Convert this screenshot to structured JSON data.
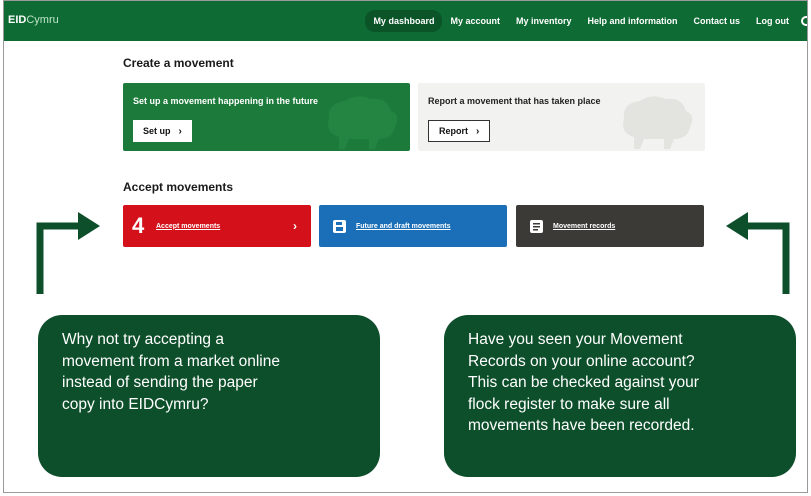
{
  "header": {
    "logo_main": "EID",
    "logo_rest": "Cymru",
    "nav": [
      {
        "label": "My dashboard",
        "active": true
      },
      {
        "label": "My account",
        "active": false
      },
      {
        "label": "My inventory",
        "active": false
      },
      {
        "label": "Help and information",
        "active": false
      },
      {
        "label": "Contact us",
        "active": false
      },
      {
        "label": "Log out",
        "active": false
      }
    ]
  },
  "create": {
    "heading": "Create a movement",
    "future_card": {
      "title": "Set up a movement happening in the future",
      "button": "Set up",
      "chevron": "›"
    },
    "past_card": {
      "title": "Report a movement that has taken place",
      "button": "Report",
      "chevron": "›"
    }
  },
  "accept": {
    "heading": "Accept movements",
    "tiles": [
      {
        "count": "4",
        "label": "Accept movements",
        "chevron": "›",
        "color": "#d4111b"
      },
      {
        "label": "Future and draft movements",
        "icon": "save-icon",
        "color": "#1a6fb8"
      },
      {
        "label": "Movement records",
        "icon": "document-icon",
        "color": "#3b3a37"
      }
    ]
  },
  "callouts": {
    "left": {
      "lines": [
        "Why not try accepting a",
        "movement from a market online",
        "instead of sending the paper",
        "copy into EIDCymru?"
      ]
    },
    "right": {
      "lines": [
        "Have you seen your Movement",
        "Records on your online account?",
        "This can be checked against your",
        "flock register to make sure all",
        "movements have been recorded."
      ]
    }
  },
  "colors": {
    "brand_green": "#0f6b34",
    "callout_green": "#0e4f2b",
    "accept_red": "#d4111b",
    "draft_blue": "#1a6fb8",
    "records_dark": "#3b3a37"
  }
}
